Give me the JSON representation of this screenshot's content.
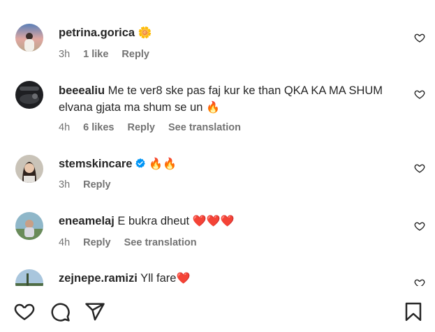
{
  "comments": [
    {
      "username": "petrina.gorica",
      "text": "",
      "emoji": "🌼",
      "time": "3h",
      "likes": "1 like",
      "reply": "Reply",
      "translation": ""
    },
    {
      "username": "beeealiu",
      "text": "Me te ver8 ske pas faj kur ke than QKA KA MA SHUM elvana gjata ma shum se un",
      "emoji": "🔥",
      "time": "4h",
      "likes": "6 likes",
      "reply": "Reply",
      "translation": "See translation"
    },
    {
      "username": "stemskincare",
      "verified": true,
      "text": "",
      "emoji": "🔥🔥",
      "time": "3h",
      "likes": "",
      "reply": "Reply",
      "translation": ""
    },
    {
      "username": "eneamelaj",
      "text": "E bukra dheut",
      "emoji": "❤️❤️❤️",
      "time": "4h",
      "likes": "",
      "reply": "Reply",
      "translation": "See translation"
    },
    {
      "username": "zejnepe.ramizi",
      "text": "Yll fare",
      "emoji": "❤️",
      "time": "",
      "likes": "",
      "reply": "",
      "translation": ""
    }
  ],
  "colors": {
    "text": "#262626",
    "meta": "#737373",
    "verified": "#0095f6",
    "red_heart": "#e0245e"
  },
  "icons": [
    "heart-icon",
    "comment-icon",
    "share-icon",
    "bookmark-icon",
    "verified-badge-icon"
  ]
}
